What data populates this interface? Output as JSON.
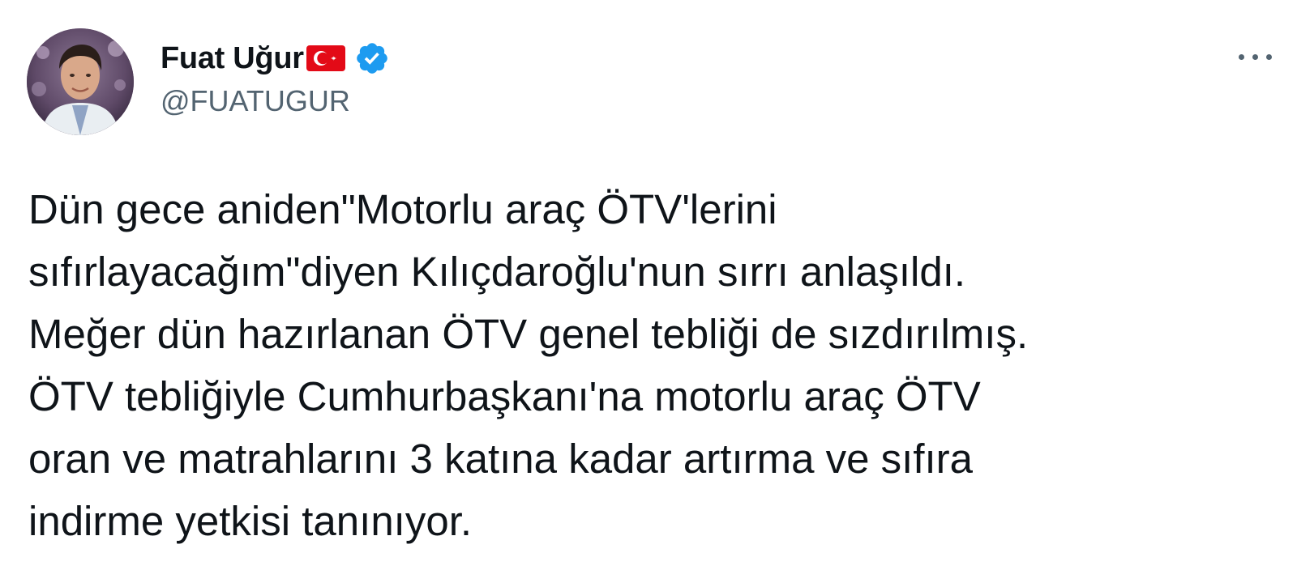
{
  "tweet": {
    "author": {
      "display_name": "Fuat Uğur",
      "handle": "@FUATUGUR",
      "flag_icon": "turkey-flag-icon",
      "verified_icon": "verified-badge-icon",
      "verified_color": "#1d9bf0",
      "avatar_icon": "avatar-photo"
    },
    "more_icon": "more-options-icon",
    "text_lines": [
      "Dün gece aniden\"Motorlu araç ÖTV'lerini",
      "sıfırlayacağım\"diyen Kılıçdaroğlu'nun sırrı anlaşıldı.",
      "Meğer dün hazırlanan ÖTV genel tebliği de sızdırılmış.",
      "ÖTV tebliğiyle Cumhurbaşkanı'na motorlu araç ÖTV",
      "oran ve matrahlarını 3 katına kadar artırma ve sıfıra",
      "indirme yetkisi tanınıyor."
    ]
  },
  "colors": {
    "text": "#0f1419",
    "secondary_text": "#536471",
    "flag_red": "#e30a17",
    "background": "#ffffff"
  }
}
